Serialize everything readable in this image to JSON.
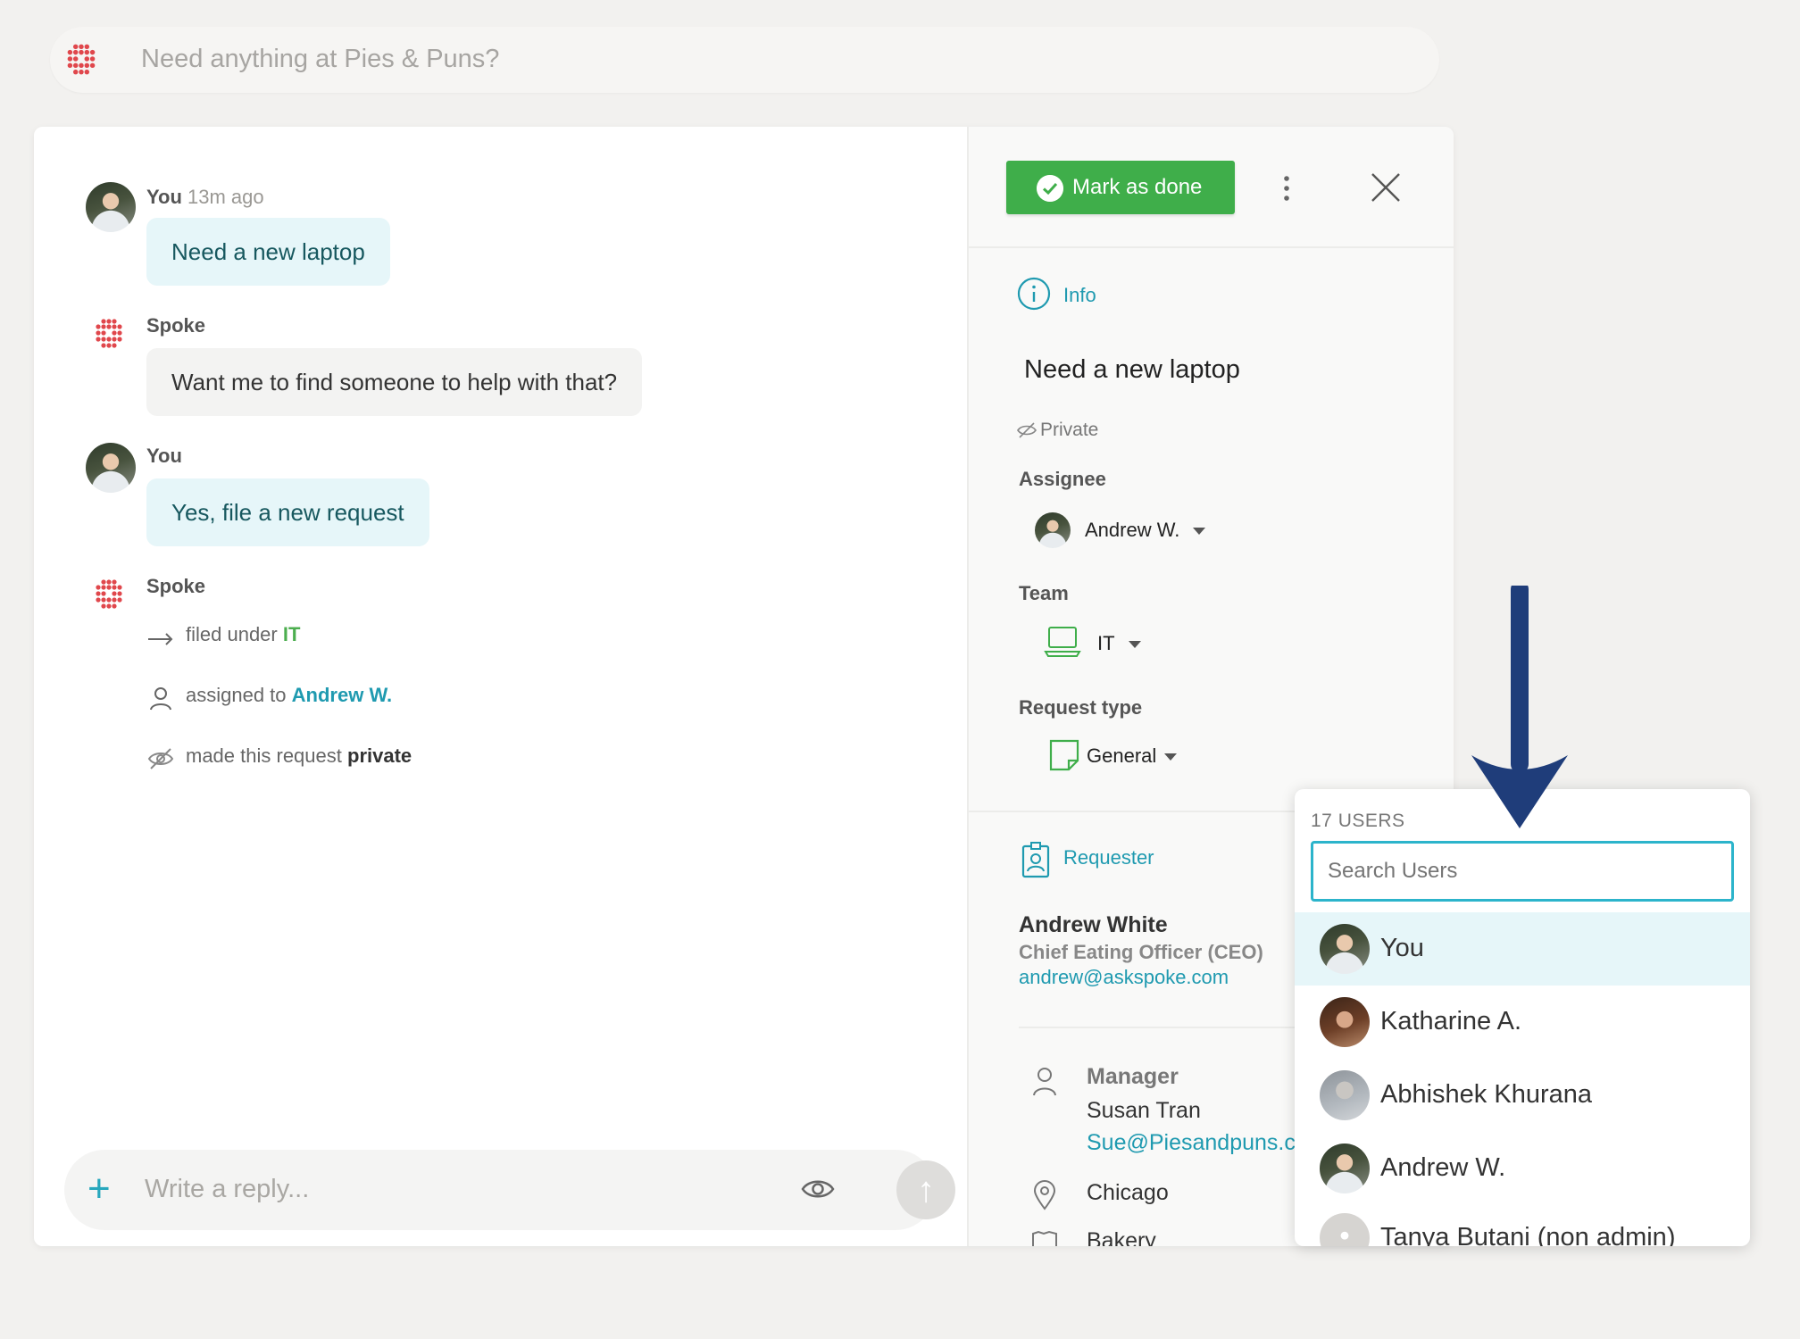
{
  "search_bar": {
    "placeholder": "Need anything at Pies & Puns?"
  },
  "conversation": {
    "messages": [
      {
        "sender": "You",
        "time": "13m ago",
        "text": "Need a new laptop"
      },
      {
        "sender": "Spoke",
        "text": "Want me to find someone to help with that?"
      },
      {
        "sender": "You",
        "text": "Yes, file a new request"
      },
      {
        "sender": "Spoke"
      }
    ],
    "events": {
      "filed_prefix": "filed under",
      "filed_value": "IT",
      "assigned_prefix": "assigned to",
      "assigned_value": "Andrew W.",
      "private_prefix": "made this request",
      "private_value": "private"
    },
    "reply_placeholder": "Write a reply...",
    "send_glyph": "↑",
    "plus_glyph": "+"
  },
  "side_panel": {
    "mark_done_label": "Mark as done",
    "info_label": "Info",
    "request_title": "Need a new laptop",
    "privacy_label": "Private",
    "assignee_label": "Assignee",
    "assignee_value": "Andrew W.",
    "team_label": "Team",
    "team_value": "IT",
    "request_type_label": "Request type",
    "request_type_value": "General",
    "requester_label": "Requester",
    "requester_name": "Andrew White",
    "requester_title": "Chief Eating Officer (CEO)",
    "requester_email": "andrew@askspoke.com",
    "manager_label": "Manager",
    "manager_name": "Susan Tran",
    "manager_email": "Sue@Piesandpuns.co",
    "location": "Chicago",
    "department": "Bakery"
  },
  "user_dropdown": {
    "count_label": "17 USERS",
    "search_placeholder": "Search Users",
    "users": [
      {
        "name": "You",
        "selected": true
      },
      {
        "name": "Katharine A."
      },
      {
        "name": "Abhishek Khurana"
      },
      {
        "name": "Andrew W."
      },
      {
        "name": "Tanya Butani (non admin)"
      }
    ]
  },
  "colors": {
    "accent_teal": "#1f9ab0",
    "done_green": "#3fae4a",
    "brand_red": "#e0474c",
    "annotation_arrow": "#1f3d7a"
  },
  "icons": [
    "spoke-logo-icon",
    "check-circle-icon",
    "kebab-menu-icon",
    "close-icon",
    "info-icon",
    "eye-slash-icon",
    "laptop-icon",
    "note-icon",
    "badge-icon",
    "person-icon",
    "location-pin-icon",
    "eye-icon",
    "arrow-right-icon",
    "plus-icon",
    "send-arrow-icon",
    "caret-down-icon"
  ]
}
